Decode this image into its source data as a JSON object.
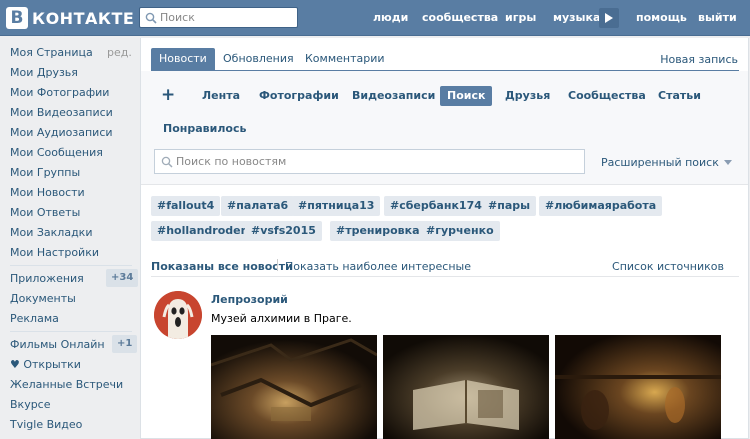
{
  "header": {
    "logo_letter": "В",
    "logo_text": "КОНТАКТЕ",
    "search_placeholder": "Поиск",
    "nav": [
      "люди",
      "сообщества",
      "игры",
      "музыка",
      "помощь",
      "выйти"
    ]
  },
  "sidebar": {
    "items": [
      {
        "label": "Моя Страница",
        "extra": "ред."
      },
      {
        "label": "Мои Друзья"
      },
      {
        "label": "Мои Фотографии"
      },
      {
        "label": "Мои Видеозаписи"
      },
      {
        "label": "Мои Аудиозаписи"
      },
      {
        "label": "Мои Сообщения"
      },
      {
        "label": "Мои Группы"
      },
      {
        "label": "Мои Новости"
      },
      {
        "label": "Мои Ответы"
      },
      {
        "label": "Мои Закладки"
      },
      {
        "label": "Мои Настройки"
      },
      {
        "label": "Приложения",
        "badge": "+34"
      },
      {
        "label": "Документы"
      },
      {
        "label": "Реклама"
      },
      {
        "label": "Фильмы Онлайн",
        "badge": "+1"
      },
      {
        "label": "♥ Открытки"
      },
      {
        "label": "Желанные Встречи"
      },
      {
        "label": "Вкурсе"
      },
      {
        "label": "Tvigle Видео"
      }
    ]
  },
  "tabs": [
    "Новости",
    "Обновления",
    "Комментарии"
  ],
  "new_post": "Новая запись",
  "filters": {
    "plus": "+",
    "items": [
      "Лента",
      "Фотографии",
      "Видеозаписи",
      "Поиск",
      "Друзья",
      "Сообщества",
      "Статьи"
    ],
    "liked": "Понравилось",
    "active": "Поиск"
  },
  "news_search": {
    "placeholder": "Поиск по новостям",
    "advanced": "Расширенный поиск"
  },
  "hashtags": [
    "#fallout4",
    "#палата6",
    "#пятница13",
    "#сбербанк174",
    "#пары",
    "#любимаяработа",
    "#hollandroden",
    "#vsfs2015",
    "#тренировка",
    "#гурченко"
  ],
  "show_options": {
    "all": "Показаны все новости",
    "interesting": "Показать наиболее интересные",
    "sources": "Список источников"
  },
  "post": {
    "author": "Лепрозорий",
    "text": "Музей алхимии в Праге."
  },
  "colors": {
    "header_bg": "#597da3",
    "link": "#2b587a",
    "page_bg": "#edeef0"
  }
}
